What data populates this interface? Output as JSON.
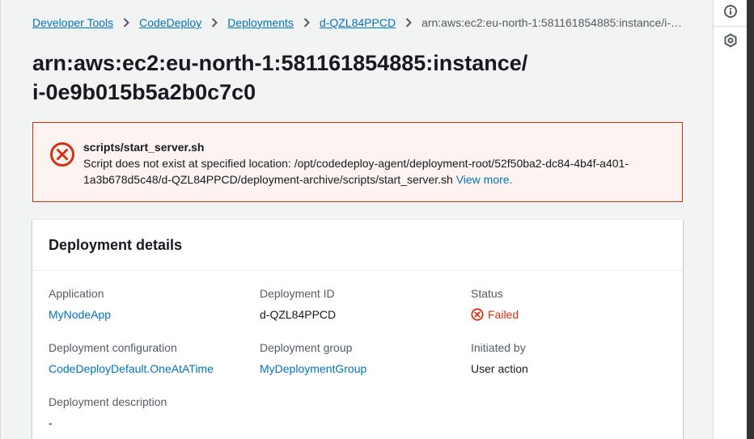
{
  "breadcrumb": {
    "items": [
      "Developer Tools",
      "CodeDeploy",
      "Deployments",
      "d-QZL84PPCD"
    ],
    "current": "arn:aws:ec2:eu-north-1:581161854885:instance/i-0e9b015b5a2b0c7c0"
  },
  "page": {
    "title_line1": "arn:aws:ec2:eu-north-1:581161854885:instance/",
    "title_line2": "i-0e9b015b5a2b0c7c0"
  },
  "alert": {
    "icon": "error-x-circle-icon",
    "title": "scripts/start_server.sh",
    "message": "Script does not exist at specified location: /opt/codedeploy-agent/deployment-root/52f50ba2-dc84-4b4f-a401-1a3b678d5c48/d-QZL84PPCD/deployment-archive/scripts/start_server.sh",
    "link": "View more."
  },
  "details": {
    "title": "Deployment details",
    "application_label": "Application",
    "application_value": "MyNodeApp",
    "deployment_id_label": "Deployment ID",
    "deployment_id_value": "d-QZL84PPCD",
    "status_label": "Status",
    "status_value": "Failed",
    "config_label": "Deployment configuration",
    "config_value": "CodeDeployDefault.OneAtATime",
    "group_label": "Deployment group",
    "group_value": "MyDeploymentGroup",
    "initiated_label": "Initiated by",
    "initiated_value": "User action",
    "description_label": "Deployment description",
    "description_value": "-"
  },
  "rail": {
    "icons": [
      "info-icon",
      "settings-hexagon-icon"
    ]
  },
  "colors": {
    "link": "#0073bb",
    "error": "#d13212",
    "error_bg": "#fdf3f1",
    "page_bg": "#f2f3f3"
  }
}
